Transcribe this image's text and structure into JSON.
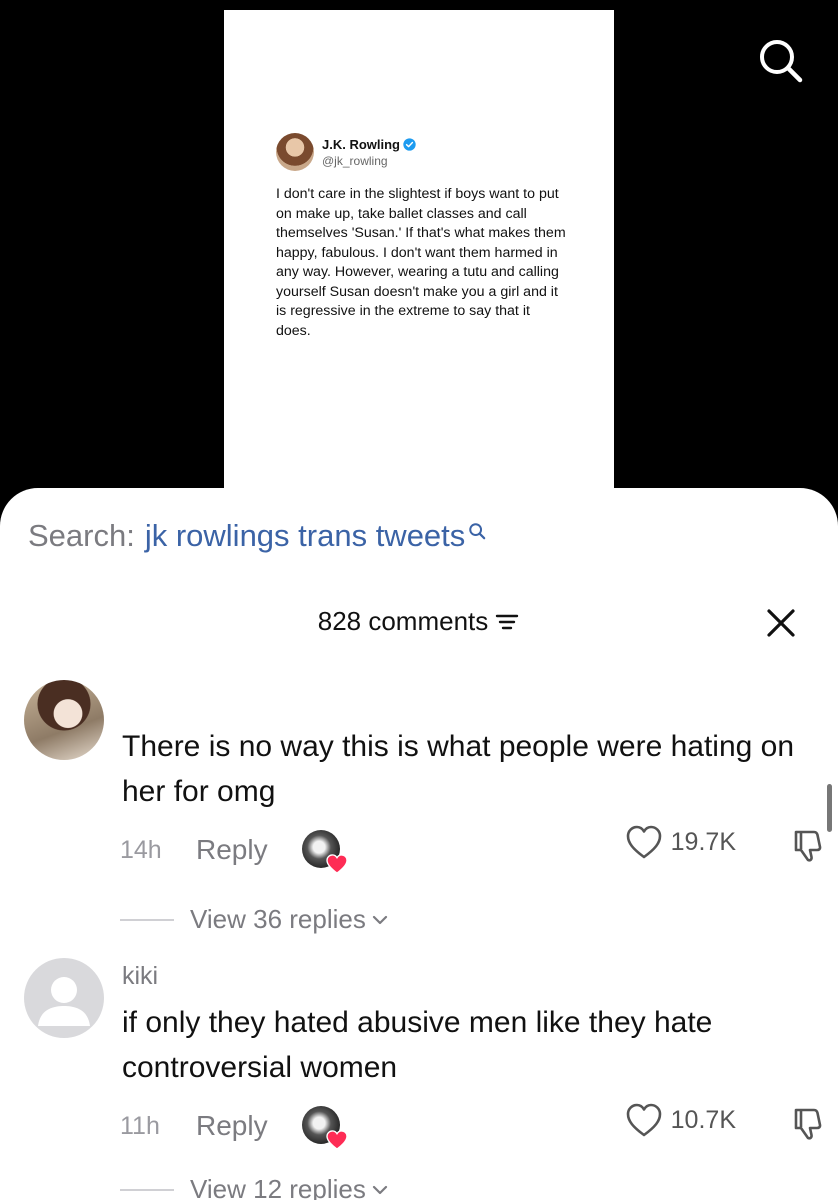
{
  "tweet": {
    "author_name": "J.K. Rowling",
    "author_handle": "@jk_rowling",
    "text": "I don't care in the slightest if boys want to put on make up, take ballet classes and call themselves 'Susan.' If that's what makes them happy, fabulous. I don't want them harmed in any way. However, wearing a tutu and calling yourself Susan doesn't make you a girl and it is regressive in the extreme to say that it does."
  },
  "search": {
    "prefix": "Search:",
    "query": "jk rowlings trans tweets"
  },
  "comments_header": {
    "count_label": "828 comments"
  },
  "comments": [
    {
      "username": "",
      "text": "There is no way this is what people were hating on her for omg",
      "time": "14h",
      "reply_label": "Reply",
      "likes": "19.7K",
      "view_replies": "View 36 replies"
    },
    {
      "username": "kiki",
      "text": "if only they hated abusive men like they hate controversial women",
      "time": "11h",
      "reply_label": "Reply",
      "likes": "10.7K",
      "view_replies": "View 12 replies"
    }
  ],
  "colors": {
    "query_blue": "#3b63a6",
    "secondary_text": "#7b7b80",
    "heart_red": "#fe2c55",
    "verified_blue": "#1d9bf0"
  },
  "icons": {
    "top_search": "search-icon",
    "filter": "filter-icon",
    "close": "close-icon",
    "like": "heart-outline-icon",
    "dislike": "thumbs-down-icon",
    "chevron": "chevron-down-icon"
  }
}
